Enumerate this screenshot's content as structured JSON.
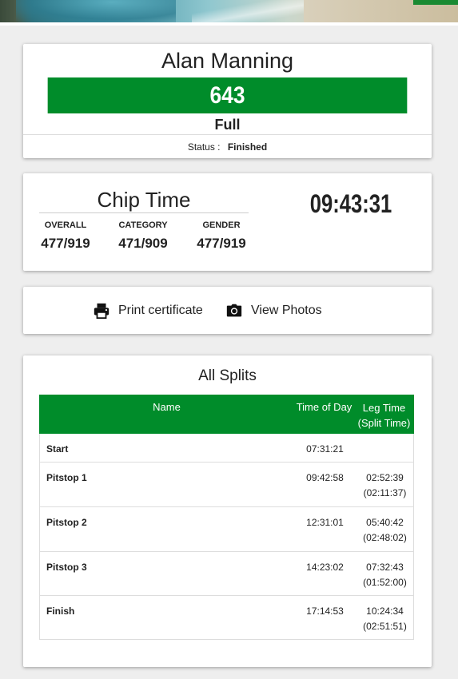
{
  "colors": {
    "brand_green": "#008c2a"
  },
  "athlete": {
    "name": "Alan Manning",
    "bib": "643",
    "race": "Full",
    "status_label": "Status :",
    "status_value": "Finished"
  },
  "result": {
    "title": "Chip Time",
    "time": "09:43:31",
    "ranks": [
      {
        "label": "OVERALL",
        "value": "477/919"
      },
      {
        "label": "CATEGORY",
        "value": "471/909"
      },
      {
        "label": "GENDER",
        "value": "477/919"
      }
    ]
  },
  "actions": {
    "print": {
      "icon": "printer-icon",
      "label": "Print certificate"
    },
    "photos": {
      "icon": "camera-icon",
      "label": "View Photos"
    }
  },
  "splits": {
    "title": "All Splits",
    "headers": {
      "name": "Name",
      "time_of_day": "Time of Day",
      "leg_time": "Leg Time",
      "split_time": "(Split Time)"
    },
    "rows": [
      {
        "name": "Start",
        "time_of_day": "07:31:21",
        "leg_time": "",
        "split_time": ""
      },
      {
        "name": "Pitstop 1",
        "time_of_day": "09:42:58",
        "leg_time": "02:52:39",
        "split_time": "(02:11:37)"
      },
      {
        "name": "Pitstop 2",
        "time_of_day": "12:31:01",
        "leg_time": "05:40:42",
        "split_time": "(02:48:02)"
      },
      {
        "name": "Pitstop 3",
        "time_of_day": "14:23:02",
        "leg_time": "07:32:43",
        "split_time": "(01:52:00)"
      },
      {
        "name": "Finish",
        "time_of_day": "17:14:53",
        "leg_time": "10:24:34",
        "split_time": "(02:51:51)"
      }
    ]
  }
}
